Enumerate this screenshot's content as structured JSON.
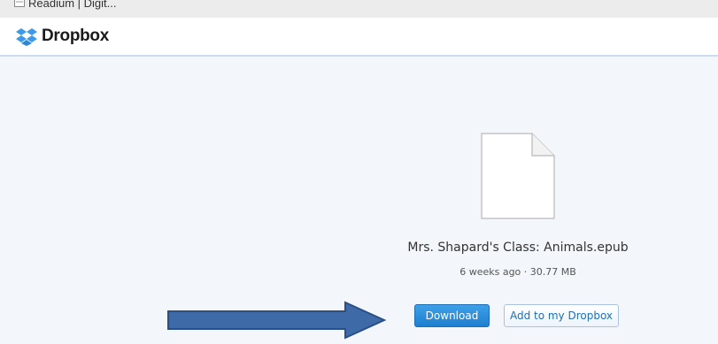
{
  "bookmarks_bar": {
    "items": [
      {
        "label": "Readium | Digit...",
        "icon": "bookmark-page-icon"
      }
    ]
  },
  "header": {
    "logo_text": "Dropbox",
    "logo_icon": "dropbox-logo-icon"
  },
  "file": {
    "icon": "document-file-icon",
    "name": "Mrs. Shapard's Class: Animals.epub",
    "meta": "6 weeks ago · 30.77 MB"
  },
  "actions": {
    "download_label": "Download",
    "add_label": "Add to my Dropbox"
  },
  "annotation": {
    "icon": "pointer-arrow-icon",
    "color": "#3f6aa8"
  },
  "colors": {
    "page_background": "#f3f7fb",
    "primary_button": "#2a8ddb",
    "secondary_button_text": "#1e6fb8"
  }
}
